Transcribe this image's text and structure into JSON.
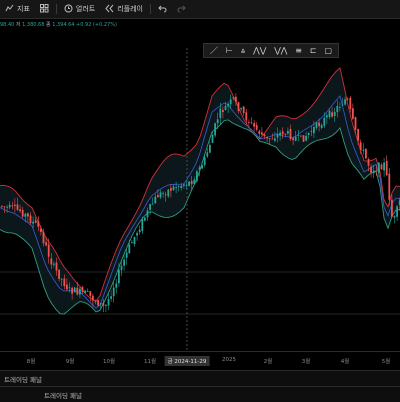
{
  "toolbar": {
    "indicators_label": "지표",
    "alert_label": "얼러트",
    "replay_label": "리플레이"
  },
  "legend": {
    "prefix": "98.40",
    "low_label": "저",
    "low_value": "1,380.68",
    "close_label": "종",
    "close_value": "1,394.64",
    "change": "+0.92 (+0.27%)"
  },
  "time_axis": {
    "ticks": [
      "8월",
      "9월",
      "10월",
      "11월",
      "2025",
      "2월",
      "3월",
      "4월",
      "5월"
    ],
    "crosshair": "금 2024-11-29"
  },
  "panels": {
    "primary": "트레이딩 패널",
    "secondary": "트레이딩 패널"
  },
  "colors": {
    "up": "#26a69a",
    "down": "#ef5350",
    "upper_band": "#d32f3a",
    "lower_band": "#2e9c82",
    "basis": "#3b5bdb"
  }
}
